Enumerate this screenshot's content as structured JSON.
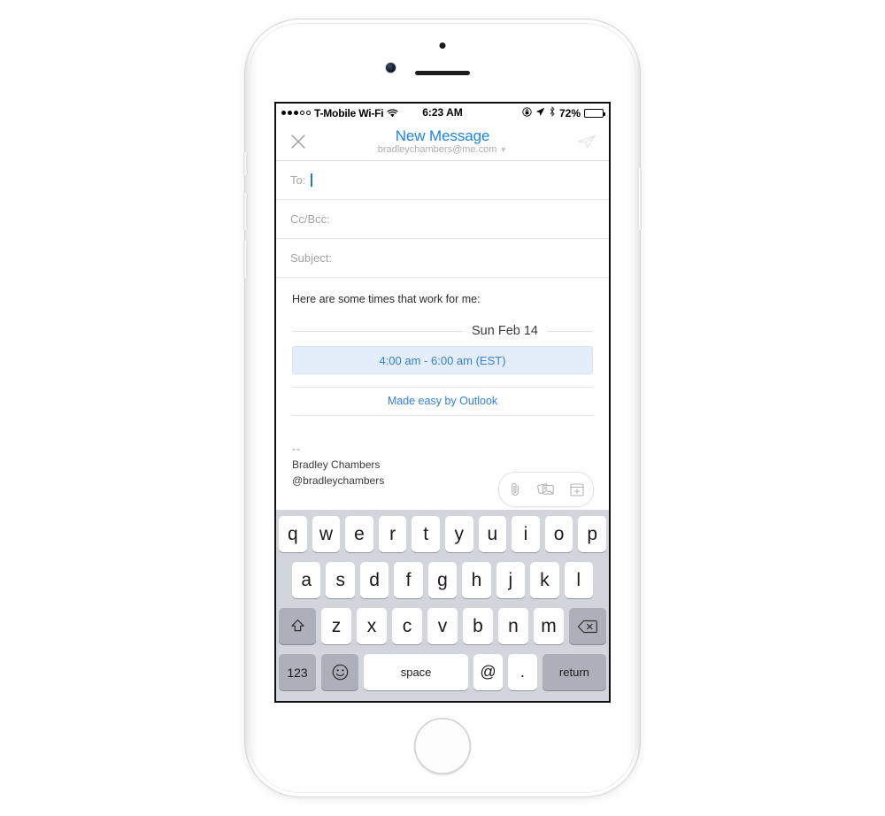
{
  "device": {
    "name": "iphone-silver",
    "home_button": "home-button"
  },
  "status_bar": {
    "signal_dots_filled": 3,
    "signal_dots_total": 5,
    "carrier": "T-Mobile Wi-Fi",
    "wifi_icon": "wifi-icon",
    "time": "6:23 AM",
    "rotation_lock_icon": "rotation-lock-icon",
    "location_icon": "location-arrow-icon",
    "bluetooth_icon": "bluetooth-icon",
    "battery_percent": "72%",
    "battery_level": 72
  },
  "nav_bar": {
    "close_icon": "close-icon",
    "title": "New Message",
    "account": "bradleychambers@me.com",
    "chevron_icon": "chevron-down-icon",
    "send_icon": "send-icon",
    "title_color": "#1d83e8"
  },
  "fields": [
    {
      "label": "To:",
      "value": "",
      "has_caret": true,
      "name": "to-field"
    },
    {
      "label": "Cc/Bcc:",
      "value": "",
      "has_caret": false,
      "name": "cc-bcc-field"
    },
    {
      "label": "Subject:",
      "value": "",
      "has_caret": false,
      "name": "subject-field"
    }
  ],
  "body": {
    "intro": "Here are some times that work for me:",
    "date_label": "Sun Feb 14",
    "time_slot": "4:00 am - 6:00 am (EST)",
    "time_slot_bg": "#e4eefb",
    "time_slot_color": "#3480dd",
    "outlook_link": "Made easy by Outlook",
    "outlook_link_color": "#2f81e0",
    "signature": {
      "dashes": "--",
      "name": "Bradley Chambers",
      "handle": "@bradleychambers"
    }
  },
  "attachment_bar": {
    "items": [
      {
        "name": "paperclip-icon",
        "label": "Attach file"
      },
      {
        "name": "photos-icon",
        "label": "Insert photo"
      },
      {
        "name": "calendar-plus-icon",
        "label": "Insert availability"
      }
    ]
  },
  "keyboard": {
    "row1": [
      "q",
      "w",
      "e",
      "r",
      "t",
      "y",
      "u",
      "i",
      "o",
      "p"
    ],
    "row2": [
      "a",
      "s",
      "d",
      "f",
      "g",
      "h",
      "j",
      "k",
      "l"
    ],
    "row3": [
      "z",
      "x",
      "c",
      "v",
      "b",
      "n",
      "m"
    ],
    "shift_icon": "shift-icon",
    "delete_icon": "delete-icon",
    "numbers_key": "123",
    "emoji_icon": "emoji-icon",
    "space_key": "space",
    "at_key": "@",
    "period_key": ".",
    "return_key": "return"
  }
}
